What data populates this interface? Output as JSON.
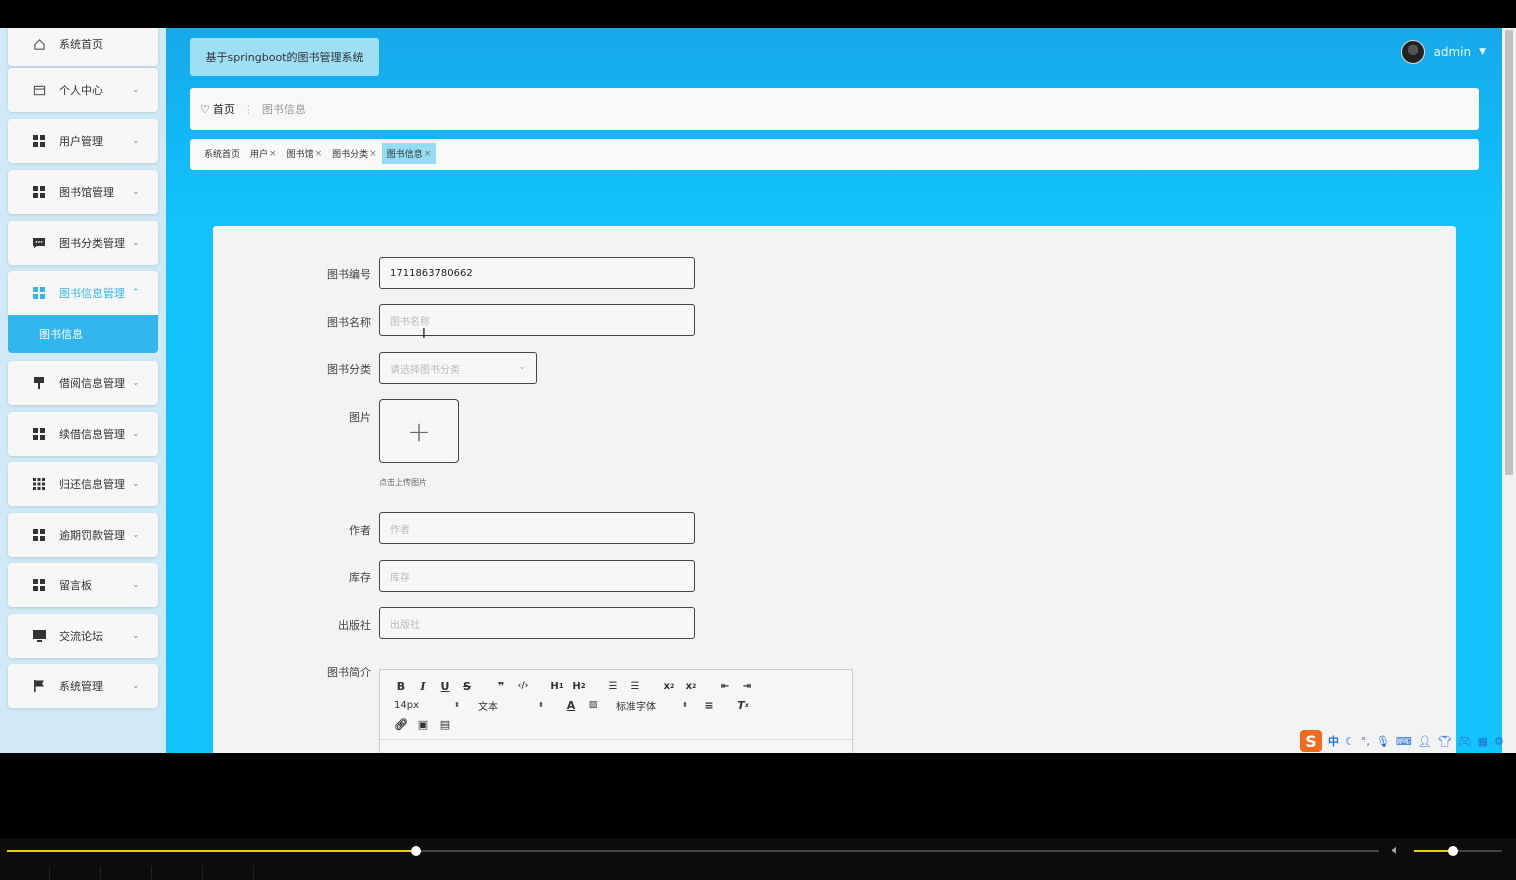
{
  "header": {
    "app_title": "基于springboot的图书管理系统",
    "user_name": "admin"
  },
  "sidebar": {
    "items": [
      {
        "label": "系统首页",
        "icon": "home-icon"
      },
      {
        "label": "个人中心",
        "icon": "calendar-icon"
      },
      {
        "label": "用户管理",
        "icon": "grid-icon"
      },
      {
        "label": "图书馆管理",
        "icon": "grid-icon"
      },
      {
        "label": "图书分类管理",
        "icon": "chat-icon"
      },
      {
        "label": "图书信息管理",
        "icon": "grid-icon"
      },
      {
        "label": "借阅信息管理",
        "icon": "pin-icon"
      },
      {
        "label": "续借信息管理",
        "icon": "grid-icon"
      },
      {
        "label": "归还信息管理",
        "icon": "apps-icon"
      },
      {
        "label": "逾期罚款管理",
        "icon": "grid-icon"
      },
      {
        "label": "留言板",
        "icon": "grid-icon"
      },
      {
        "label": "交流论坛",
        "icon": "monitor-icon"
      },
      {
        "label": "系统管理",
        "icon": "flag-icon"
      }
    ],
    "submenu_label": "图书信息"
  },
  "breadcrumb": {
    "home": "首页",
    "current": "图书信息"
  },
  "tabs": [
    {
      "label": "系统首页",
      "closable": false
    },
    {
      "label": "用户",
      "closable": true
    },
    {
      "label": "图书馆",
      "closable": true
    },
    {
      "label": "图书分类",
      "closable": true
    },
    {
      "label": "图书信息",
      "closable": true
    }
  ],
  "form": {
    "book_no_label": "图书编号",
    "book_no_value": "1711863780662",
    "book_name_label": "图书名称",
    "book_name_placeholder": "图书名称",
    "category_label": "图书分类",
    "category_placeholder": "请选择图书分类",
    "image_label": "图片",
    "upload_hint": "点击上传图片",
    "author_label": "作者",
    "author_placeholder": "作者",
    "stock_label": "库存",
    "stock_placeholder": "库存",
    "publisher_label": "出版社",
    "publisher_placeholder": "出版社",
    "intro_label": "图书简介"
  },
  "editor": {
    "font_size": "14px",
    "text_style": "文本",
    "font_family": "标准字体"
  },
  "ime": {
    "lang": "中"
  },
  "player": {
    "progress_percent": 29.8,
    "volume_percent": 44
  },
  "colors": {
    "accent": "#33b5ee",
    "progress": "#f0c419"
  }
}
